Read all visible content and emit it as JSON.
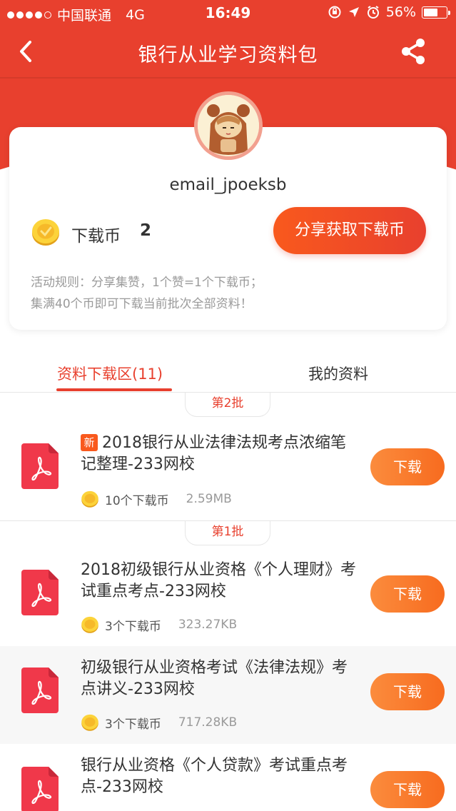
{
  "status": {
    "carrier": "中国联通",
    "network": "4G",
    "time": "16:49",
    "battery": "56%"
  },
  "nav": {
    "title": "银行从业学习资料包"
  },
  "profile": {
    "username": "email_jpoeksb",
    "coin_label": "下载币",
    "coin_count": "2",
    "share_button": "分享获取下载币",
    "rules_line1": "活动规则：分享集赞，1个赞=1个下载币；",
    "rules_line2": "集满40个币即可下载当前批次全部资料！"
  },
  "tabs": [
    {
      "label": "资料下载区(11)"
    },
    {
      "label": "我的资料"
    }
  ],
  "batches": [
    {
      "label": "第2批"
    },
    {
      "label": "第1批"
    }
  ],
  "items": [
    {
      "badge": "新",
      "title": "2018银行从业法律法规考点浓缩笔记整理-233网校",
      "coins": "10个下载币",
      "size": "2.59MB",
      "button": "下载"
    },
    {
      "title": "2018初级银行从业资格《个人理财》考试重点考点-233网校",
      "coins": "3个下载币",
      "size": "323.27KB",
      "button": "下载"
    },
    {
      "title": "初级银行从业资格考试《法律法规》考点讲义-233网校",
      "coins": "3个下载币",
      "size": "717.28KB",
      "button": "下载"
    },
    {
      "title": "银行从业资格《个人贷款》考试重点考点-233网校",
      "button": "下载"
    }
  ],
  "colors": {
    "brand_red": "#e8402e",
    "button_orange": "#f76b1f",
    "muted_text": "#9a9a9a"
  }
}
